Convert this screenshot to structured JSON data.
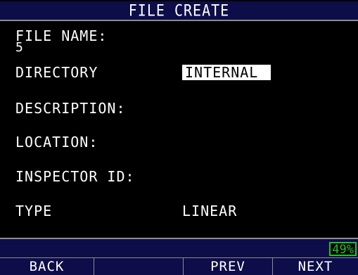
{
  "header": {
    "title": "FILE CREATE"
  },
  "form": {
    "file_name_label": "FILE NAME:",
    "file_name_value": "5",
    "directory_label": "DIRECTORY",
    "directory_value": "INTERNAL",
    "description_label": "DESCRIPTION:",
    "location_label": "LOCATION:",
    "inspector_id_label": "INSPECTOR ID:",
    "type_label": "TYPE",
    "type_value": "LINEAR"
  },
  "status": {
    "battery": "49%"
  },
  "softkeys": {
    "key1": "BACK",
    "key2": "",
    "key3": "",
    "key4": "PREV",
    "key5": "NEXT"
  },
  "colors": {
    "background": "#000000",
    "bar": "#0d0d4a",
    "text": "#ffffff",
    "highlight": "#ffffff",
    "battery": "#22c322",
    "divider": "#8c8c8c"
  }
}
